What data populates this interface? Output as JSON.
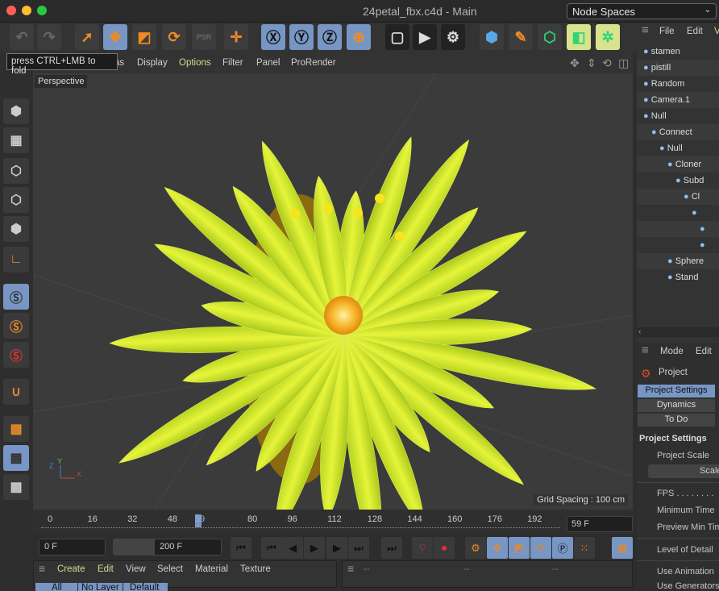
{
  "window": {
    "title": "24petal_fbx.c4d - Main",
    "node_spaces": "Node Spaces"
  },
  "tooltip": "press CTRL+LMB to fold",
  "toolbar": {
    "icons": [
      "undo-icon",
      "redo-icon",
      "select-icon",
      "move-icon",
      "scale-icon",
      "rotate-icon",
      "psr-icon",
      "axis-move-icon",
      "x-axis-icon",
      "y-axis-icon",
      "z-axis-icon",
      "world-coord-icon",
      "render-view-icon",
      "render-icon",
      "render-settings-icon",
      "cube-icon",
      "pen-icon",
      "subdivision-icon",
      "extrude-icon",
      "deformer-icon"
    ],
    "psr_label": "PSR"
  },
  "viewport_menu": {
    "items": [
      "as",
      "Display",
      "Options",
      "Filter",
      "Panel",
      "ProRender"
    ],
    "camera_label": "Perspective",
    "grid_spacing": "Grid Spacing : 100 cm",
    "axis": [
      "Z",
      "Y",
      "X"
    ]
  },
  "timeline": {
    "ticks": [
      "0",
      "16",
      "32",
      "48",
      "59",
      "80",
      "96",
      "112",
      "128",
      "144",
      "160",
      "176",
      "192"
    ],
    "current": "59",
    "current_frame": "59 F",
    "start": "0 F",
    "end": "200 F",
    "value": 59,
    "max": 200
  },
  "material_manager": {
    "menu": [
      "Create",
      "Edit",
      "View",
      "Select",
      "Material",
      "Texture"
    ],
    "tabs": [
      "All",
      "No Layer",
      "Default"
    ]
  },
  "attr_bottom": [
    "--",
    "--",
    "--"
  ],
  "object_manager": {
    "menu": [
      "File",
      "Edit",
      "V"
    ],
    "objects": [
      {
        "name": "stamen",
        "depth": 0
      },
      {
        "name": "pistill",
        "depth": 0
      },
      {
        "name": "Random",
        "depth": 0
      },
      {
        "name": "Camera.1",
        "depth": 0
      },
      {
        "name": "Null",
        "depth": 0
      },
      {
        "name": "Connect",
        "depth": 1
      },
      {
        "name": "Null",
        "depth": 2
      },
      {
        "name": "Cloner",
        "depth": 3
      },
      {
        "name": "Subd",
        "depth": 4
      },
      {
        "name": "Cl",
        "depth": 5
      },
      {
        "name": "",
        "depth": 6
      },
      {
        "name": "",
        "depth": 7
      },
      {
        "name": "",
        "depth": 7
      },
      {
        "name": "Sphere",
        "depth": 3
      },
      {
        "name": "Stand",
        "depth": 3
      }
    ]
  },
  "attributes": {
    "menu": [
      "Mode",
      "Edit"
    ],
    "object": "Project",
    "tabs": [
      "Project Settings",
      "Dynamics",
      "To Do"
    ],
    "section": "Project Settings",
    "fields": [
      "Project Scale",
      "Scale",
      "FPS . . . . . . . .",
      "Minimum Time",
      "Preview Min Time",
      "Level of Detail",
      "Use Animation",
      "Use Generators"
    ]
  },
  "colors": {
    "accent": "#7796c4",
    "orange": "#f08a24",
    "petal": "#c6e02a",
    "menu_highlight": "#d4d88a"
  }
}
